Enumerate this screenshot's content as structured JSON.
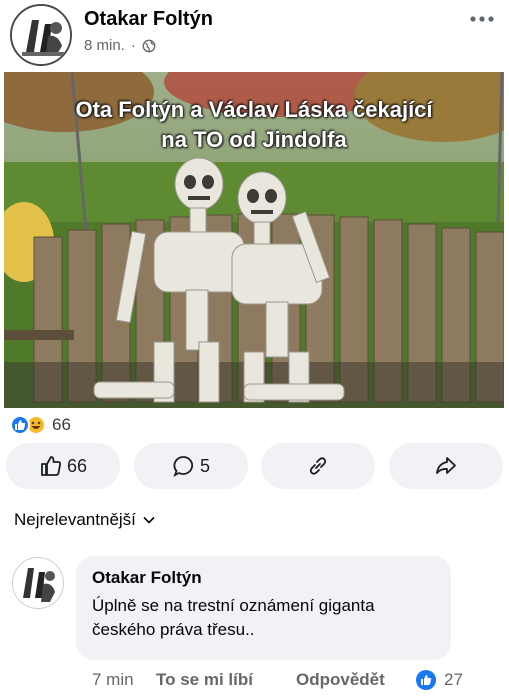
{
  "post": {
    "author": "Otakar Foltýn",
    "time": "8 min.",
    "separator": "·",
    "image_caption_line1": "Ota Foltýn a Václav Láska čekající",
    "image_caption_line2": "na TO od Jindolfa",
    "reaction_count": "66"
  },
  "actions": {
    "like_count": "66",
    "comment_count": "5"
  },
  "sort": {
    "label": "Nejrelevantnější"
  },
  "comment": {
    "author": "Otakar Foltýn",
    "text_line1": "Úplně se na trestní oznámení giganta",
    "text_line2": "českého práva třesu..",
    "time": "7 min",
    "like_label": "To se mi líbí",
    "reply_label": "Odpovědět",
    "like_count": "27"
  },
  "colors": {
    "brand_blue": "#1877f2",
    "pill_bg": "#f0f2f5",
    "muted_text": "#65676b"
  }
}
